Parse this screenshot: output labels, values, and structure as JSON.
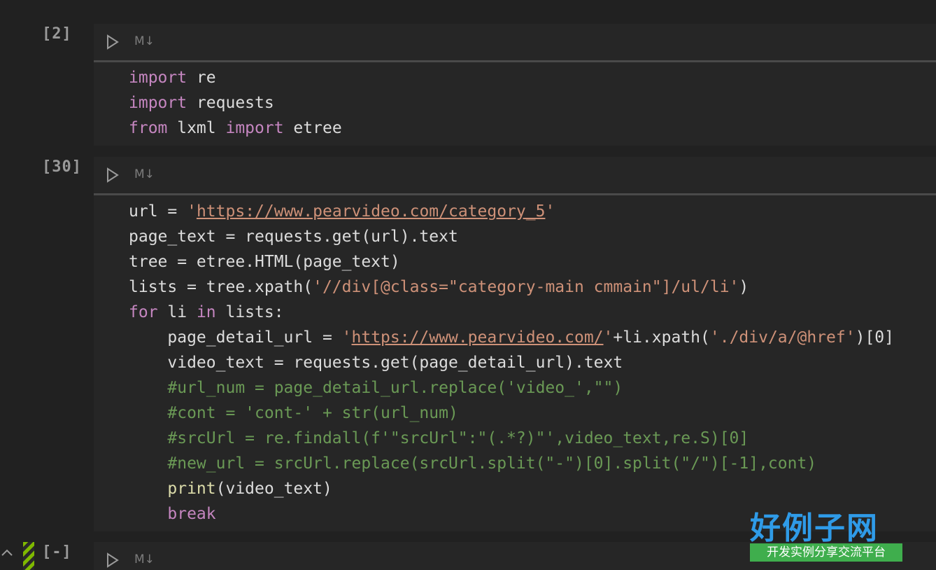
{
  "cells": [
    {
      "exec_count": "[2]",
      "toolbar_label": "M↓"
    },
    {
      "exec_count": "[30]",
      "toolbar_label": "M↓"
    },
    {
      "exec_count": "[-]",
      "toolbar_label": "M↓"
    }
  ],
  "code1": {
    "l1_kw": "import",
    "l1_rest": " re",
    "l2_kw": "import",
    "l2_rest": " requests",
    "l3_kw": "from",
    "l3_mid": " lxml ",
    "l3_kw2": "import",
    "l3_rest": " etree"
  },
  "code2": {
    "l1_a": "url = ",
    "l1_q1": "'",
    "l1_url": "https://www.pearvideo.com/category_5",
    "l1_q2": "'",
    "l2": "page_text = requests.get(url).text",
    "l3": "tree = etree.HTML(page_text)",
    "l4_a": "lists = tree.xpath(",
    "l4_s": "'//div[@class=\"category-main cmmain\"]/ul/li'",
    "l4_b": ")",
    "l5_kw": "for",
    "l5_mid": " li ",
    "l5_kw2": "in",
    "l5_rest": " lists:",
    "l6_a": "    page_detail_url = ",
    "l6_q1": "'",
    "l6_url": "https://www.pearvideo.com/",
    "l6_q2": "'",
    "l6_b": "+li.xpath(",
    "l6_s": "'./div/a/@href'",
    "l6_c": ")[0]",
    "l7": "    video_text = requests.get(page_detail_url).text",
    "l8": "    #url_num = page_detail_url.replace('video_',\"\")",
    "l9": "    #cont = 'cont-' + str(url_num)",
    "l10": "    #srcUrl = re.findall(f'\"srcUrl\":\"(.*?)\"',video_text,re.S)[0]",
    "l11": "    #new_url = srcUrl.replace(srcUrl.split(\"-\")[0].split(\"/\")[-1],cont)",
    "l12_pad": "    ",
    "l12_fn": "print",
    "l12_rest": "(video_text)",
    "l13_pad": "    ",
    "l13_kw": "break"
  },
  "logo": {
    "big_text": "好例子网",
    "band_text": "开发实例分享交流平台"
  },
  "colors": {
    "keyword": "#c586c0",
    "string": "#ce9178",
    "comment": "#6a9955",
    "function": "#dcdcaa",
    "text": "#dcdcdc",
    "background": "#212121"
  },
  "icons": [
    "run-icon",
    "collapse-chevron-icon"
  ]
}
